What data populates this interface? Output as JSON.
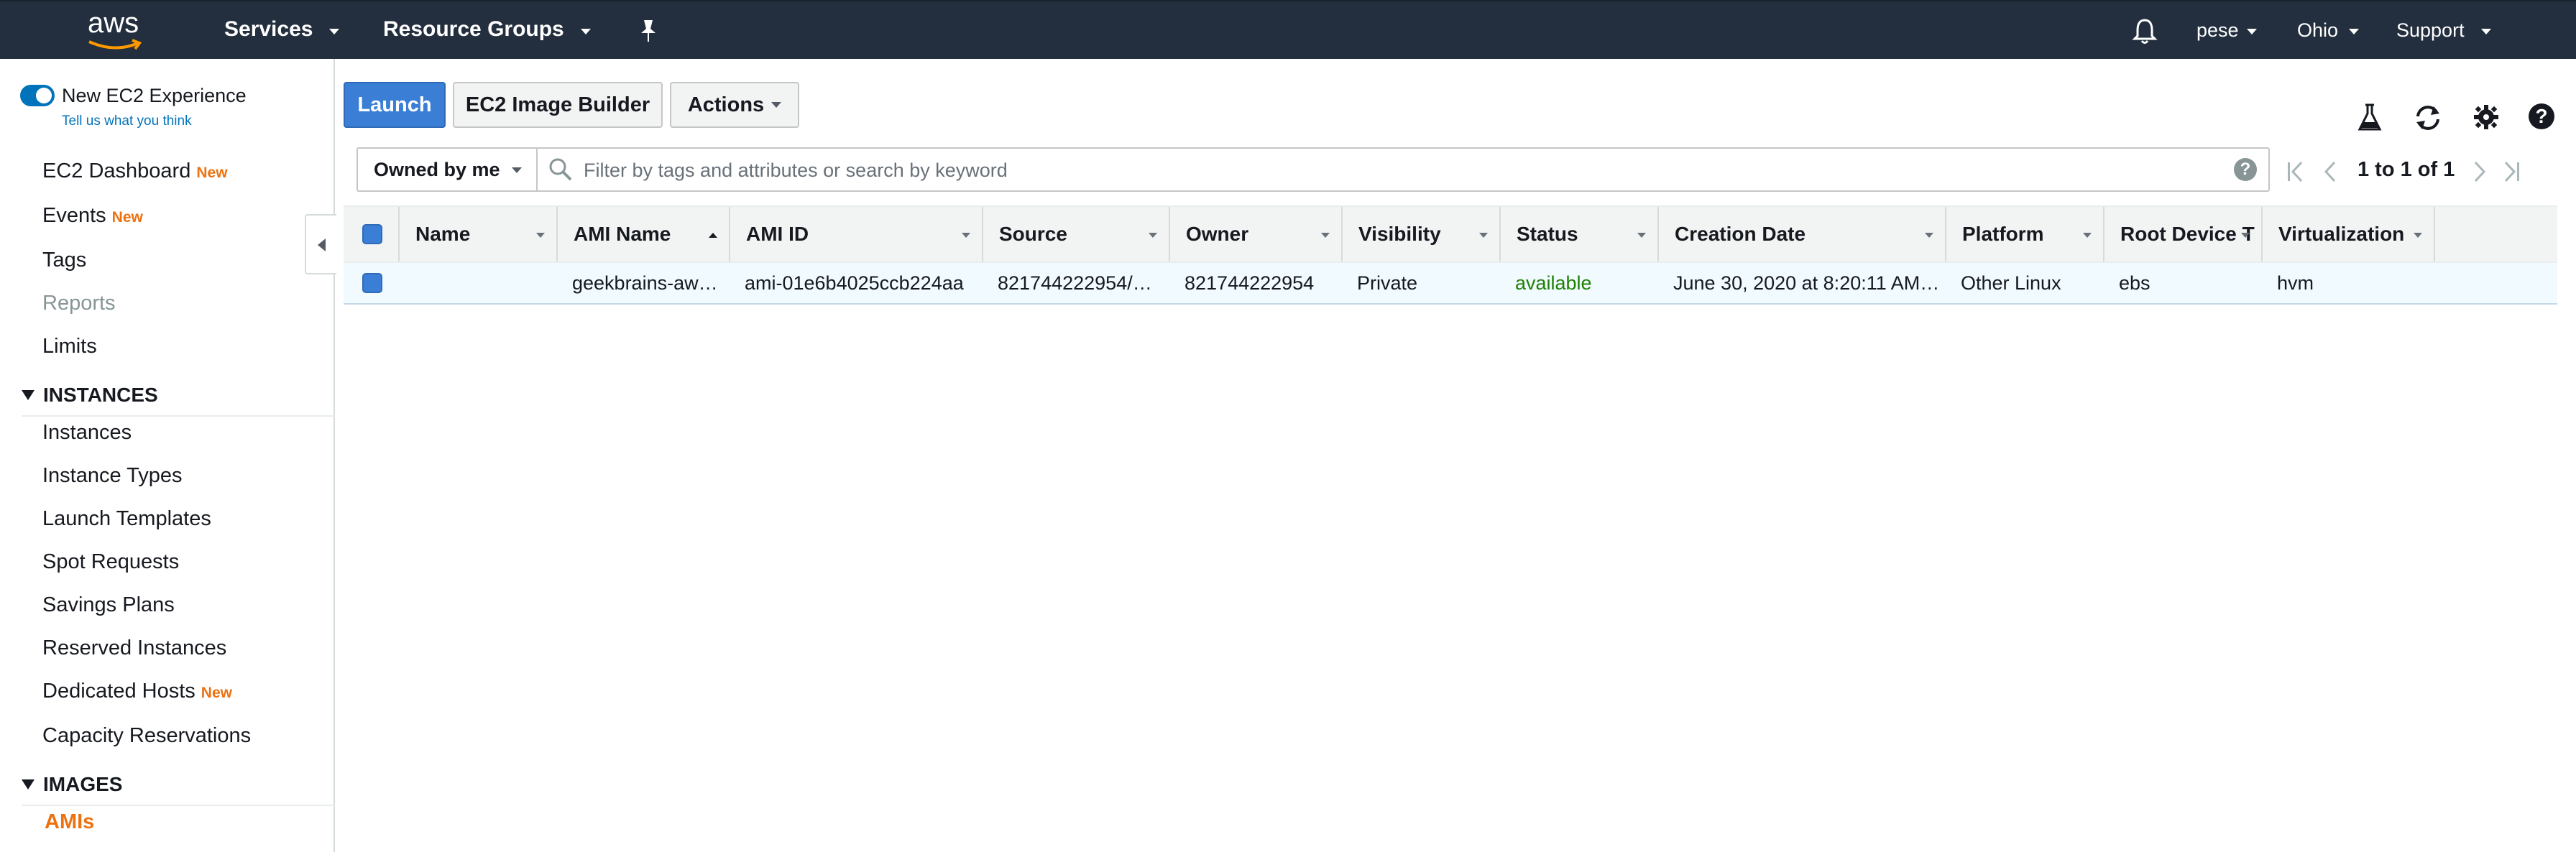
{
  "topnav": {
    "logo_text": "aws",
    "services": "Services",
    "resource_groups": "Resource Groups",
    "user": "pese",
    "region": "Ohio",
    "support": "Support"
  },
  "sidebar": {
    "new_experience_label": "New EC2 Experience",
    "feedback_link": "Tell us what you think",
    "items_top": [
      {
        "label": "EC2 Dashboard",
        "badge": "New"
      },
      {
        "label": "Events",
        "badge": "New"
      },
      {
        "label": "Tags",
        "badge": ""
      },
      {
        "label": "Reports",
        "badge": ""
      },
      {
        "label": "Limits",
        "badge": ""
      }
    ],
    "instances_header": "INSTANCES",
    "instances_items": [
      {
        "label": "Instances",
        "badge": ""
      },
      {
        "label": "Instance Types",
        "badge": ""
      },
      {
        "label": "Launch Templates",
        "badge": ""
      },
      {
        "label": "Spot Requests",
        "badge": ""
      },
      {
        "label": "Savings Plans",
        "badge": ""
      },
      {
        "label": "Reserved Instances",
        "badge": ""
      },
      {
        "label": "Dedicated Hosts",
        "badge": "New"
      },
      {
        "label": "Capacity Reservations",
        "badge": ""
      }
    ],
    "images_header": "IMAGES",
    "images_items": [
      {
        "label": "AMIs",
        "badge": ""
      }
    ]
  },
  "toolbar": {
    "launch": "Launch",
    "image_builder": "EC2 Image Builder",
    "actions": "Actions"
  },
  "filter": {
    "owner_select": "Owned by me",
    "placeholder": "Filter by tags and attributes or search by keyword",
    "value": ""
  },
  "pager": {
    "text": "1 to 1 of 1"
  },
  "table": {
    "columns": [
      "Name",
      "AMI Name",
      "AMI ID",
      "Source",
      "Owner",
      "Visibility",
      "Status",
      "Creation Date",
      "Platform",
      "Root Device T",
      "Virtualization"
    ],
    "rows": [
      {
        "name": "",
        "ami_name": "geekbrains-aw…",
        "ami_id": "ami-01e6b4025ccb224aa",
        "source": "821744222954/…",
        "owner": "821744222954",
        "visibility": "Private",
        "status": "available",
        "creation_date": "June 30, 2020 at 8:20:11 AM…",
        "platform": "Other Linux",
        "root_device": "ebs",
        "virtualization": "hvm"
      }
    ]
  },
  "colors": {
    "nav_bg": "#232f3e",
    "primary": "#3a7fd5",
    "accent_orange": "#ec7211",
    "status_green": "#1d8102",
    "toggle_blue": "#0073bb"
  }
}
